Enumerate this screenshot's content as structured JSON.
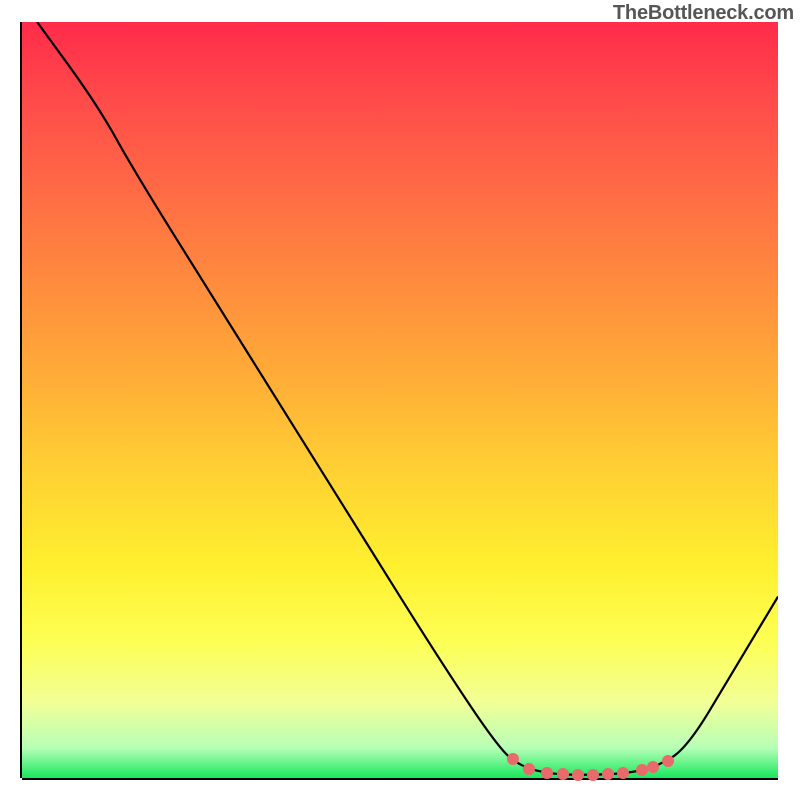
{
  "watermark": "TheBottleneck.com",
  "chart_data": {
    "type": "line",
    "title": "",
    "xlabel": "",
    "ylabel": "",
    "xlim": [
      0,
      100
    ],
    "ylim": [
      0,
      100
    ],
    "series": [
      {
        "name": "curve",
        "points": [
          {
            "x": 2,
            "y": 100
          },
          {
            "x": 10,
            "y": 89
          },
          {
            "x": 15,
            "y": 80
          },
          {
            "x": 25,
            "y": 64
          },
          {
            "x": 35,
            "y": 48
          },
          {
            "x": 45,
            "y": 32
          },
          {
            "x": 55,
            "y": 16
          },
          {
            "x": 63,
            "y": 4
          },
          {
            "x": 66,
            "y": 1.5
          },
          {
            "x": 70,
            "y": 0.5
          },
          {
            "x": 75,
            "y": 0.4
          },
          {
            "x": 80,
            "y": 0.6
          },
          {
            "x": 84,
            "y": 1.5
          },
          {
            "x": 88,
            "y": 4
          },
          {
            "x": 94,
            "y": 14
          },
          {
            "x": 100,
            "y": 24
          }
        ]
      }
    ],
    "marker_color": "#e86a6a",
    "markers": [
      {
        "x": 65,
        "y": 2.5
      },
      {
        "x": 67,
        "y": 1.2
      },
      {
        "x": 69.5,
        "y": 0.7
      },
      {
        "x": 71.5,
        "y": 0.5
      },
      {
        "x": 73.5,
        "y": 0.4
      },
      {
        "x": 75.5,
        "y": 0.4
      },
      {
        "x": 77.5,
        "y": 0.5
      },
      {
        "x": 79.5,
        "y": 0.6
      },
      {
        "x": 82,
        "y": 1.0
      },
      {
        "x": 83.5,
        "y": 1.4
      },
      {
        "x": 85.5,
        "y": 2.2
      }
    ]
  }
}
